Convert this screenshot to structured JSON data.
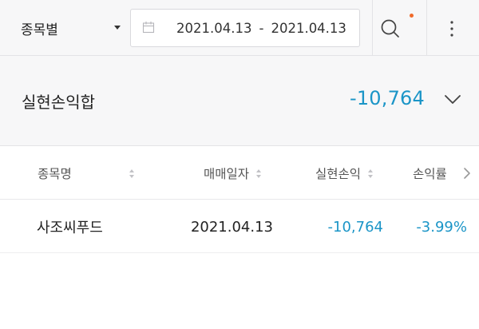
{
  "toolbar": {
    "filter_label": "종목별",
    "date_from": "2021.04.13",
    "date_separator": "-",
    "date_to": "2021.04.13"
  },
  "summary": {
    "title": "실현손익합",
    "value": "-10,764"
  },
  "table": {
    "columns": [
      "종목명",
      "매매일자",
      "실현손익",
      "손익률"
    ],
    "rows": [
      {
        "name": "사조씨푸드",
        "date": "2021.04.13",
        "pnl": "-10,764",
        "rate": "-3.99%"
      }
    ]
  },
  "colors": {
    "accent": "#1b95c7",
    "notification_dot": "#f06a2a",
    "panel_bg": "#f7f7f8"
  },
  "icons": {
    "calendar": "calendar-icon",
    "search": "search-icon",
    "more": "more-vertical-icon",
    "expand": "chevron-down-icon",
    "sort": "sort-icon",
    "next": "chevron-right-icon"
  }
}
